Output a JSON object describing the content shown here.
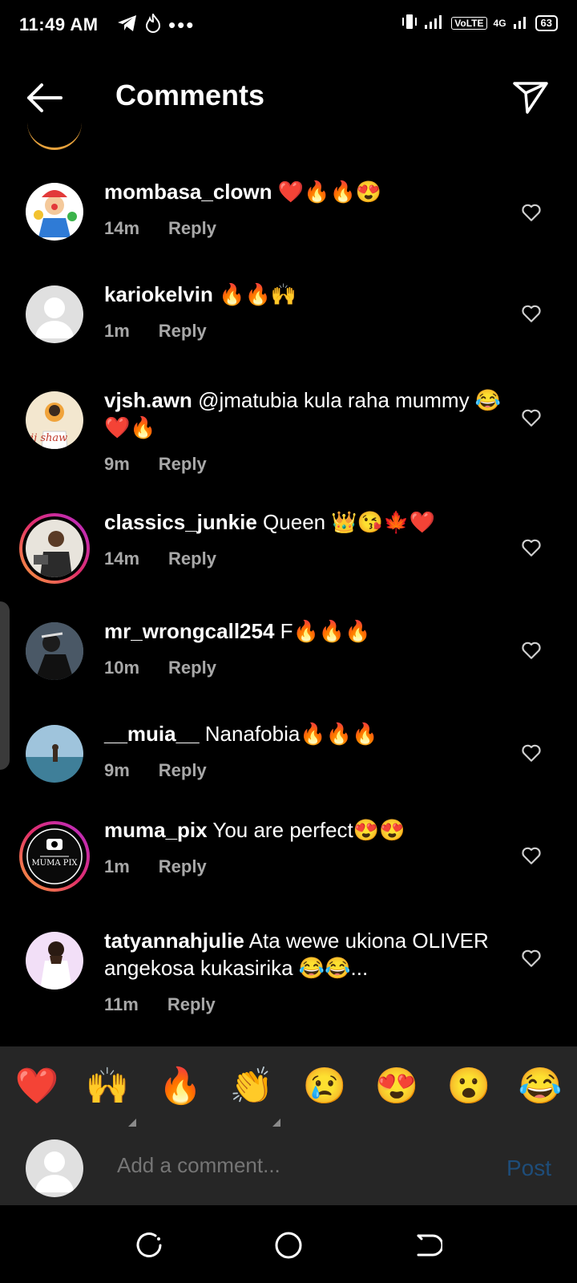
{
  "status_bar": {
    "time": "11:49 AM",
    "volte": "VoLTE",
    "network": "4G",
    "battery": "63"
  },
  "header": {
    "title": "Comments"
  },
  "comments": [
    {
      "user": "mombasa_clown",
      "text": "❤️🔥🔥😍",
      "time": "14m",
      "reply": "Reply"
    },
    {
      "user": "kariokelvin",
      "text": "🔥🔥🙌",
      "time": "1m",
      "reply": "Reply"
    },
    {
      "user": "vjsh.awn",
      "text": "@jmatubia  kula raha mummy 😂❤️🔥",
      "time": "9m",
      "reply": "Reply"
    },
    {
      "user": "classics_junkie",
      "text": "Queen 👑😘🍁❤️",
      "time": "14m",
      "reply": "Reply"
    },
    {
      "user": "mr_wrongcall254",
      "text": "F🔥🔥🔥",
      "time": "10m",
      "reply": "Reply"
    },
    {
      "user": "__muia__",
      "text": "Nanafobia🔥🔥🔥",
      "time": "9m",
      "reply": "Reply"
    },
    {
      "user": "muma_pix",
      "text": "You are perfect😍😍",
      "time": "1m",
      "reply": "Reply",
      "avatar_text": "MUMA PIX"
    },
    {
      "user": "tatyannahjulie",
      "text": "Ata wewe ukiona OLIVER angekosa kukasirika 😂😂...",
      "time": "11m",
      "reply": "Reply"
    }
  ],
  "reactions": [
    "❤️",
    "🙌",
    "🔥",
    "👏",
    "😢",
    "😍",
    "😮",
    "😂"
  ],
  "input": {
    "placeholder": "Add a comment...",
    "post_label": "Post"
  },
  "colors": {
    "background": "#000000",
    "muted_text": "#a8a8a8",
    "post_disabled": "#1e4d7a",
    "story_ring": "#e22e6a"
  }
}
